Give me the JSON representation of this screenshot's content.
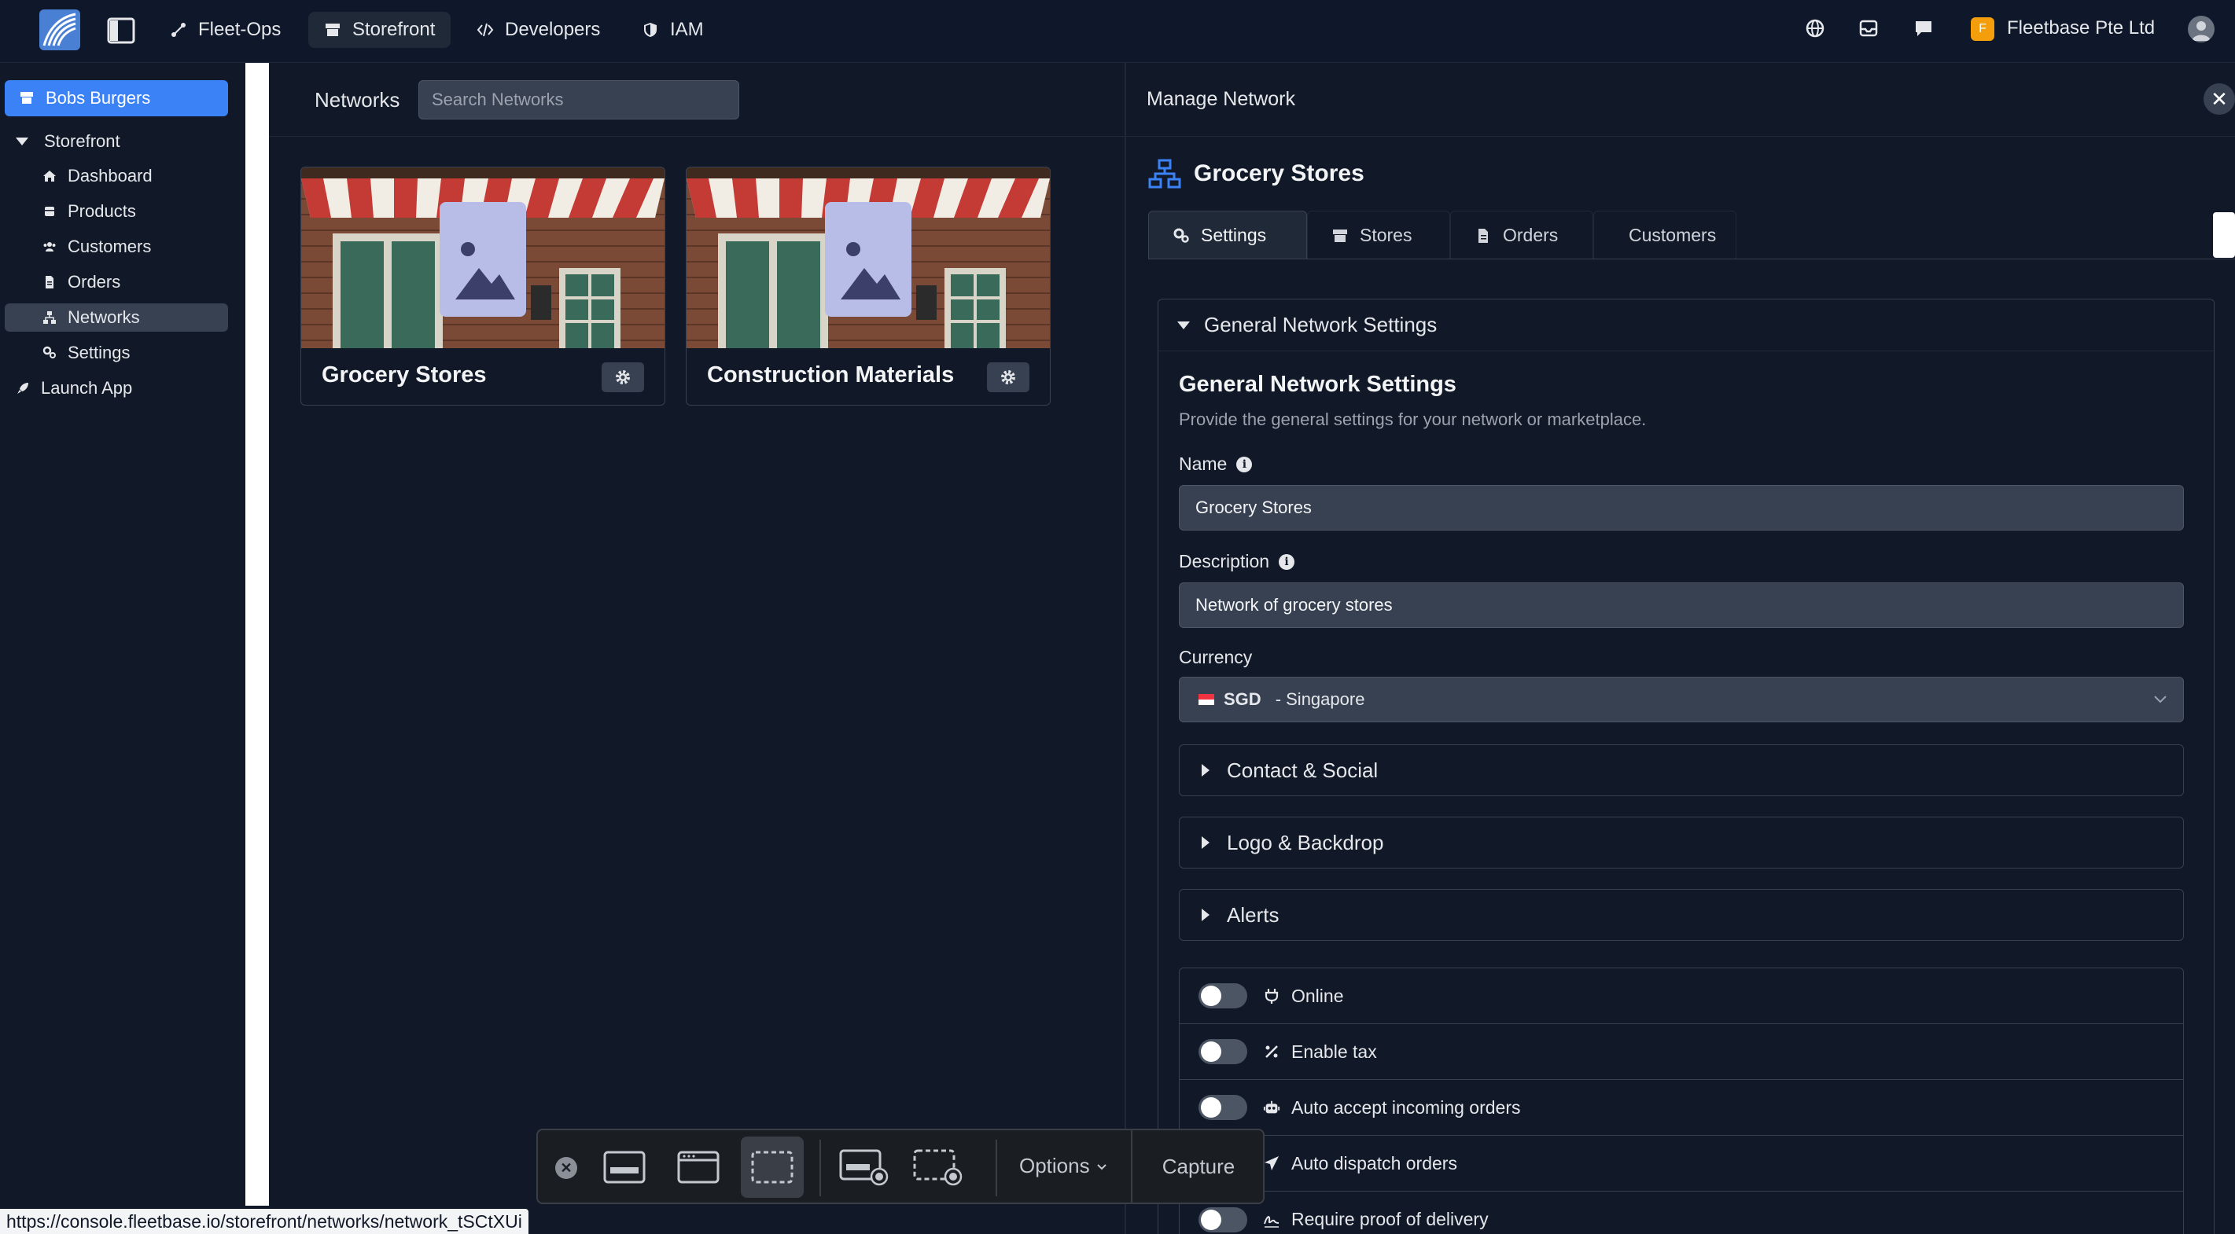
{
  "topbar": {
    "nav": [
      {
        "label": "Fleet-Ops",
        "icon": "route-icon"
      },
      {
        "label": "Storefront",
        "icon": "store-icon",
        "active": true
      },
      {
        "label": "Developers",
        "icon": "code-icon"
      },
      {
        "label": "IAM",
        "icon": "shield-icon"
      }
    ],
    "org_initial": "F",
    "org_name": "Fleetbase Pte Ltd"
  },
  "sidebar": {
    "store_switcher": "Bobs Burgers",
    "section": "Storefront",
    "items": [
      {
        "label": "Dashboard",
        "icon": "home-icon"
      },
      {
        "label": "Products",
        "icon": "box-icon"
      },
      {
        "label": "Customers",
        "icon": "users-icon"
      },
      {
        "label": "Orders",
        "icon": "file-icon"
      },
      {
        "label": "Networks",
        "icon": "network-icon",
        "active": true
      },
      {
        "label": "Settings",
        "icon": "gears-icon"
      }
    ],
    "launch": "Launch App"
  },
  "main": {
    "title": "Networks",
    "search_placeholder": "Search Networks",
    "cards": [
      {
        "name": "Grocery Stores"
      },
      {
        "name": "Construction Materials"
      }
    ]
  },
  "panel": {
    "title": "Manage Network",
    "network_name": "Grocery Stores",
    "tabs": [
      {
        "label": "Settings",
        "active": true
      },
      {
        "label": "Stores"
      },
      {
        "label": "Orders"
      },
      {
        "label": "Customers"
      }
    ],
    "section_toggle": "General Network Settings",
    "form": {
      "heading": "General Network Settings",
      "subheading": "Provide the general settings for your network or marketplace.",
      "name_label": "Name",
      "name_value": "Grocery Stores",
      "description_label": "Description",
      "description_value": "Network of grocery stores",
      "currency_label": "Currency",
      "currency_code": "SGD",
      "currency_name": "- Singapore"
    },
    "subsections": [
      "Contact & Social",
      "Logo & Backdrop",
      "Alerts"
    ],
    "toggles": [
      {
        "label": "Online",
        "on": false
      },
      {
        "label": "Enable tax",
        "on": false
      },
      {
        "label": "Auto accept incoming orders",
        "on": false
      },
      {
        "label": "Auto dispatch orders",
        "on": false
      },
      {
        "label": "Require proof of delivery",
        "on": false
      }
    ]
  },
  "capture_toolbar": {
    "options": "Options",
    "capture": "Capture"
  },
  "status_url": "https://console.fleetbase.io/storefront/networks/network_tSCtXUi",
  "colors": {
    "accent": "#3b82f6",
    "background": "#111827",
    "org_badge": "#f59e0b"
  }
}
